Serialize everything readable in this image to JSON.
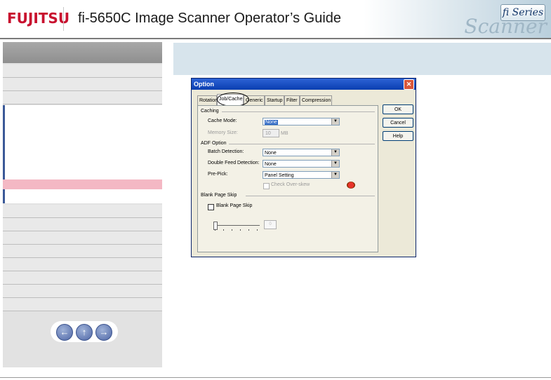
{
  "header": {
    "logo": "FUJITSU",
    "title": "fi-5650C Image Scanner Operator’s Guide",
    "badge": "fi Series",
    "banner_text": "Scanner"
  },
  "nav": {
    "back": "←",
    "up": "↑",
    "forward": "→"
  },
  "dialog": {
    "title": "Option",
    "close": "✕",
    "tabs": [
      "Rotation",
      "Job/Cache",
      "Generic",
      "Startup",
      "Filter",
      "Compression"
    ],
    "caching": {
      "group": "Caching",
      "cache_mode_label": "Cache Mode:",
      "cache_mode_value": "None",
      "memory_size_label": "Memory Size:",
      "memory_size_value": "10",
      "memory_unit": "MB"
    },
    "adf": {
      "group": "ADF Option",
      "batch_label": "Batch Detection:",
      "batch_value": "None",
      "double_feed_label": "Double Feed Detection:",
      "double_feed_value": "None",
      "prepick_label": "Pre-Pick:",
      "prepick_value": "Panel Setting",
      "check_overskew": "Check Over-skew"
    },
    "blank": {
      "group": "Blank Page Skip",
      "checkbox": "Blank Page Skip",
      "value": "0"
    },
    "buttons": {
      "ok": "OK",
      "cancel": "Cancel",
      "help": "Help"
    }
  }
}
